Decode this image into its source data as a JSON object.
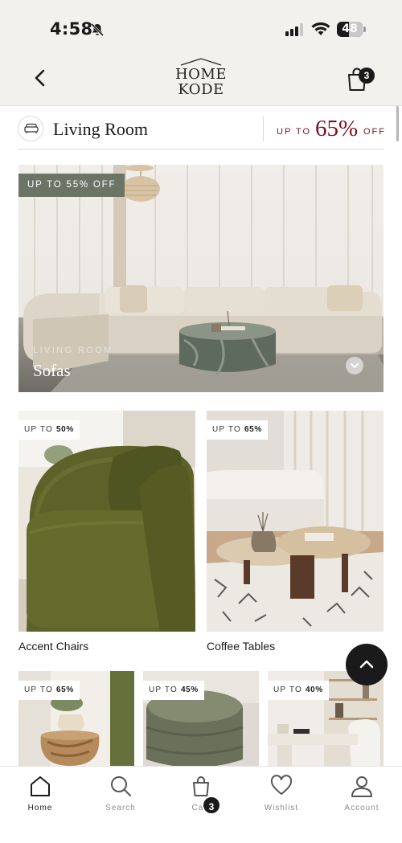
{
  "status_bar": {
    "time": "4:58",
    "battery_text": "48",
    "battery_level": 0.48,
    "icons": [
      "bell-slash-icon",
      "cellular-signal-icon",
      "wifi-icon",
      "battery-icon"
    ]
  },
  "header": {
    "logo_line1": "HOME",
    "logo_line2": "KODE",
    "cart_count": "3",
    "icons": [
      "chevron-left-icon",
      "shopping-bag-icon"
    ]
  },
  "category": {
    "title": "Living Room",
    "promo_prefix": "UP TO",
    "promo_percent": "65%",
    "promo_suffix": "OFF",
    "icon": "sofa-icon"
  },
  "hero": {
    "badge": "UP TO 55% OFF",
    "subtitle": "LIVING ROOM",
    "title": "Sofas"
  },
  "tiles": [
    {
      "label": "Accent Chairs",
      "badge_prefix": "UP TO",
      "badge_value": "50%"
    },
    {
      "label": "Coffee Tables",
      "badge_prefix": "UP TO",
      "badge_value": "65%"
    },
    {
      "label": "",
      "badge_prefix": "UP TO",
      "badge_value": "65%"
    },
    {
      "label": "",
      "badge_prefix": "UP TO",
      "badge_value": "45%"
    },
    {
      "label": "",
      "badge_prefix": "UP TO",
      "badge_value": "40%"
    }
  ],
  "bottom_nav": {
    "items": [
      {
        "label": "Home",
        "icon": "home-icon",
        "active": true
      },
      {
        "label": "Search",
        "icon": "search-icon",
        "active": false
      },
      {
        "label": "Cart",
        "icon": "shopping-bag-icon",
        "active": false
      },
      {
        "label": "Wishlist",
        "icon": "heart-icon",
        "active": false
      },
      {
        "label": "Account",
        "icon": "user-icon",
        "active": false
      }
    ],
    "cart_count": "3"
  },
  "colors": {
    "accent": "#7a1020",
    "hero_badge_bg": "#6a7566",
    "header_bg": "#f3f1ee",
    "dark": "#1a1a1a"
  }
}
